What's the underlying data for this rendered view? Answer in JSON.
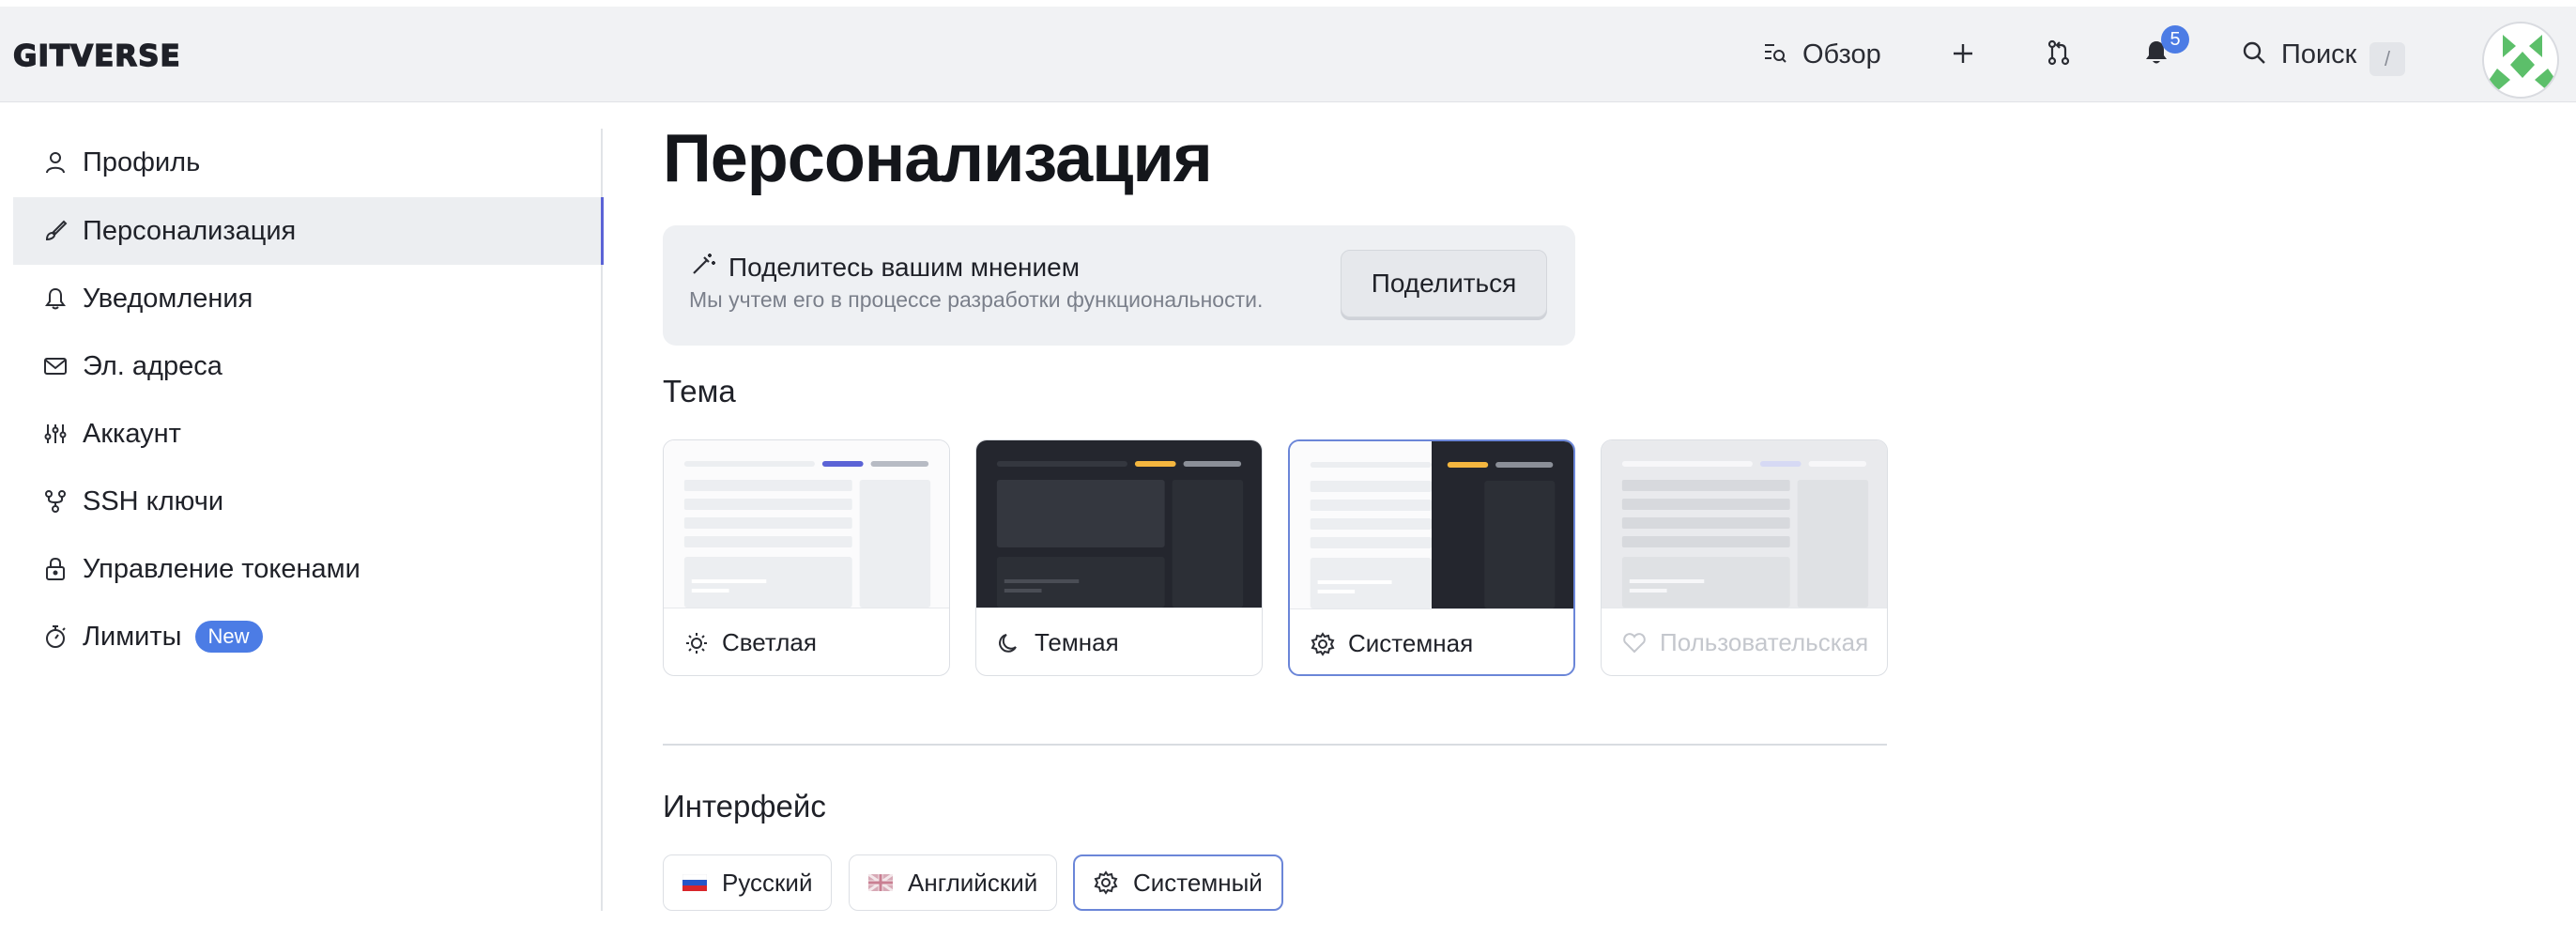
{
  "header": {
    "logo_text": "GITVERSE",
    "overview_label": "Обзор",
    "notifications_count": "5",
    "search_label": "Поиск",
    "search_shortcut": "/"
  },
  "sidebar": {
    "items": [
      {
        "label": "Профиль",
        "icon": "user-icon"
      },
      {
        "label": "Персонализация",
        "icon": "brush-icon",
        "active": true
      },
      {
        "label": "Уведомления",
        "icon": "bell-icon"
      },
      {
        "label": "Эл. адреса",
        "icon": "mail-icon"
      },
      {
        "label": "Аккаунт",
        "icon": "sliders-icon"
      },
      {
        "label": "SSH ключи",
        "icon": "key-fork-icon"
      },
      {
        "label": "Управление токенами",
        "icon": "lock-icon"
      },
      {
        "label": "Лимиты",
        "icon": "timer-icon",
        "badge": "New"
      }
    ]
  },
  "main": {
    "title": "Персонализация",
    "feedback": {
      "title": "Поделитесь вашим мнением",
      "subtitle": "Мы учтем его в процессе разработки функциональности.",
      "button": "Поделиться"
    },
    "theme": {
      "heading": "Тема",
      "options": [
        {
          "label": "Светлая",
          "icon": "sun-icon"
        },
        {
          "label": "Темная",
          "icon": "moon-icon"
        },
        {
          "label": "Системная",
          "icon": "gear-icon",
          "selected": true
        },
        {
          "label": "Пользовательская",
          "icon": "heart-icon",
          "disabled": true
        }
      ]
    },
    "interface": {
      "heading": "Интерфейс",
      "languages": [
        {
          "label": "Русский",
          "icon": "russia-flag-icon"
        },
        {
          "label": "Английский",
          "icon": "uk-flag-icon"
        },
        {
          "label": "Системный",
          "icon": "gear-icon",
          "selected": true
        }
      ]
    }
  },
  "colors": {
    "accent": "#4c7ce5",
    "selected_border": "#6b86d8",
    "header_bg": "#f1f2f4"
  }
}
